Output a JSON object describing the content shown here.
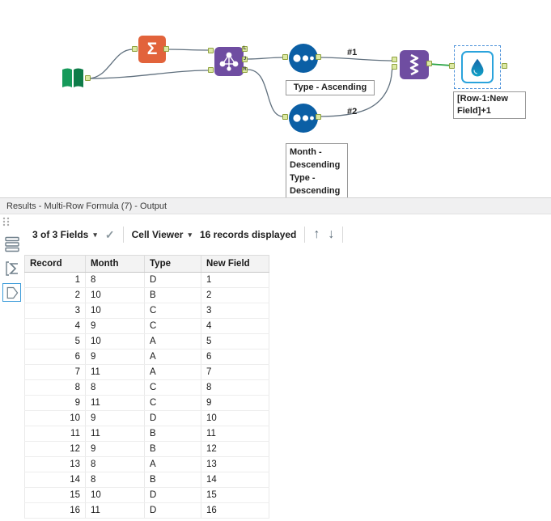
{
  "icons": {
    "caret_down": "▾",
    "check": "✓",
    "arrow_up": "↑",
    "arrow_down": "↓",
    "summarize_sigma": "Σ"
  },
  "canvas": {
    "connection_labels": [
      "#1",
      "#2"
    ],
    "join_output_labels": [
      "L",
      "J",
      "R"
    ],
    "annotations": {
      "sort1": "Type - Ascending",
      "sort2_lines": [
        "Month -",
        "Descending",
        "Type -",
        "Descending"
      ],
      "multirow_lines": [
        "[Row-1:New",
        "Field]+1"
      ]
    },
    "colors": {
      "input_green": "#169a5a",
      "summarize_orange": "#e2633b",
      "join_purple": "#6f4da1",
      "sort_blue": "#0b5fa5",
      "union_purple": "#6f4da1",
      "multirow_border_blue": "#2aa3dc",
      "wire_gray": "#60707e",
      "selected_wire_green": "#27a343",
      "anchor_fill": "#dce9a4",
      "anchor_border": "#8fa13e",
      "selection_dashed_blue": "#4a90d9"
    }
  },
  "results": {
    "title": "Results - Multi-Row Formula (7) - Output",
    "toolbar": {
      "fields_dropdown": "3 of 3 Fields",
      "cell_viewer_dropdown": "Cell Viewer",
      "records_text": "16 records displayed"
    },
    "table": {
      "columns": [
        "Record",
        "Month",
        "Type",
        "New Field"
      ],
      "rows": [
        [
          "1",
          "8",
          "D",
          "1"
        ],
        [
          "2",
          "10",
          "B",
          "2"
        ],
        [
          "3",
          "10",
          "C",
          "3"
        ],
        [
          "4",
          "9",
          "C",
          "4"
        ],
        [
          "5",
          "10",
          "A",
          "5"
        ],
        [
          "6",
          "9",
          "A",
          "6"
        ],
        [
          "7",
          "11",
          "A",
          "7"
        ],
        [
          "8",
          "8",
          "C",
          "8"
        ],
        [
          "9",
          "11",
          "C",
          "9"
        ],
        [
          "10",
          "9",
          "D",
          "10"
        ],
        [
          "11",
          "11",
          "B",
          "11"
        ],
        [
          "12",
          "9",
          "B",
          "12"
        ],
        [
          "13",
          "8",
          "A",
          "13"
        ],
        [
          "14",
          "8",
          "B",
          "14"
        ],
        [
          "15",
          "10",
          "D",
          "15"
        ],
        [
          "16",
          "11",
          "D",
          "16"
        ]
      ]
    }
  }
}
